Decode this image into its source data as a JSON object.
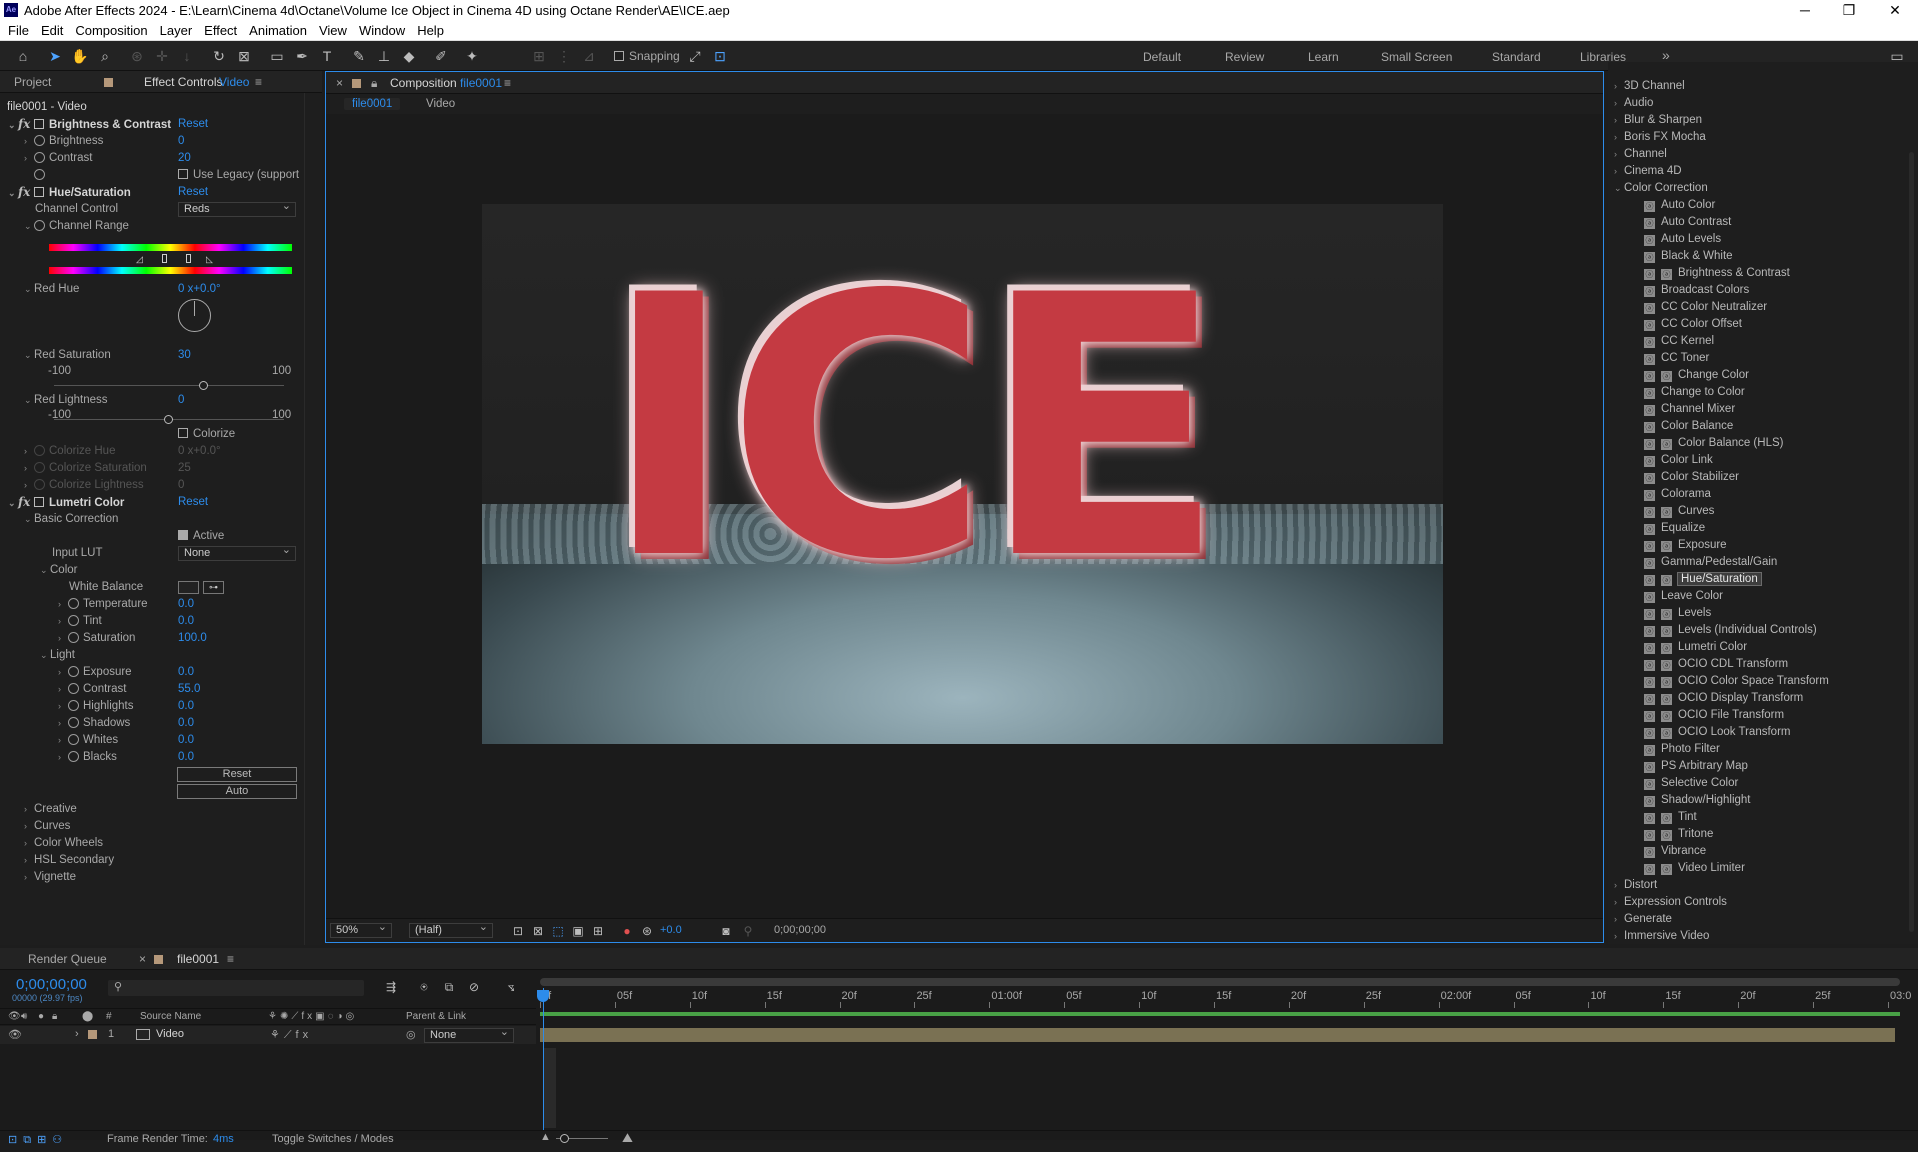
{
  "title_bar": {
    "app_icon": "Ae",
    "title": "Adobe After Effects 2024 - E:\\Learn\\Cinema 4d\\Octane\\Volume Ice Object in Cinema 4D using Octane Render\\AE\\ICE.aep",
    "minimize": "─",
    "maximize": "❐",
    "close": "✕"
  },
  "menu": [
    "File",
    "Edit",
    "Composition",
    "Layer",
    "Effect",
    "Animation",
    "View",
    "Window",
    "Help"
  ],
  "toolbar": {
    "snapping_label": "Snapping",
    "workspaces": [
      "Default",
      "Review",
      "Learn",
      "Small Screen",
      "Standard",
      "Libraries"
    ],
    "more": "»"
  },
  "effect_controls": {
    "tab_project": "Project",
    "tab_effect_controls": "Effect Controls",
    "tab_layer": "Video",
    "layer_path": "file0001 - Video",
    "brightness_contrast": {
      "name": "Brightness & Contrast",
      "reset": "Reset",
      "brightness_label": "Brightness",
      "brightness_value": "0",
      "contrast_label": "Contrast",
      "contrast_value": "20",
      "legacy_label": "Use Legacy (support"
    },
    "hue_saturation": {
      "name": "Hue/Saturation",
      "reset": "Reset",
      "channel_control_label": "Channel Control",
      "channel_control_value": "Reds",
      "channel_range_label": "Channel Range",
      "red_hue_label": "Red Hue",
      "red_hue_value": "0 x+0.0°",
      "red_sat_label": "Red Saturation",
      "red_sat_value": "30",
      "red_sat_min": "-100",
      "red_sat_max": "100",
      "red_sat_level": 0.65,
      "red_light_label": "Red Lightness",
      "red_light_value": "0",
      "red_light_min": "-100",
      "red_light_max": "100",
      "red_light_level": 0.5,
      "colorize_label": "Colorize",
      "colorize_hue_label": "Colorize Hue",
      "colorize_hue_value": "0 x+0.0°",
      "colorize_sat_label": "Colorize Saturation",
      "colorize_sat_value": "25",
      "colorize_light_label": "Colorize Lightness",
      "colorize_light_value": "0"
    },
    "lumetri": {
      "name": "Lumetri Color",
      "reset": "Reset",
      "basic_correction": "Basic Correction",
      "active_label": "Active",
      "input_lut_label": "Input LUT",
      "input_lut_value": "None",
      "color_group": "Color",
      "white_balance_label": "White Balance",
      "temperature_label": "Temperature",
      "temperature_value": "0.0",
      "tint_label": "Tint",
      "tint_value": "0.0",
      "saturation_label": "Saturation",
      "saturation_value": "100.0",
      "light_group": "Light",
      "exposure_label": "Exposure",
      "exposure_value": "0.0",
      "contrast_label": "Contrast",
      "contrast_value": "55.0",
      "highlights_label": "Highlights",
      "highlights_value": "0.0",
      "shadows_label": "Shadows",
      "shadows_value": "0.0",
      "whites_label": "Whites",
      "whites_value": "0.0",
      "blacks_label": "Blacks",
      "blacks_value": "0.0",
      "reset_button": "Reset",
      "auto_button": "Auto",
      "sections": [
        "Creative",
        "Curves",
        "Color Wheels",
        "HSL Secondary",
        "Vignette"
      ]
    }
  },
  "composition": {
    "tab_prefix": "Composition",
    "tab_name": "file0001",
    "breadcrumb_comp": "file0001",
    "breadcrumb_layer": "Video",
    "viewer_text": "ICE",
    "footer": {
      "zoom": "50%",
      "resolution": "(Half)",
      "exposure": "+0.0",
      "timecode": "0;00;00;00"
    }
  },
  "effects_panel": {
    "top_categories": [
      "3D Channel",
      "Audio",
      "Blur & Sharpen",
      "Boris FX Mocha",
      "Channel",
      "Cinema 4D"
    ],
    "open_category": "Color Correction",
    "items": [
      {
        "label": "Auto Color",
        "badge": false
      },
      {
        "label": "Auto Contrast",
        "badge": false
      },
      {
        "label": "Auto Levels",
        "badge": false
      },
      {
        "label": "Black & White",
        "badge": false
      },
      {
        "label": "Brightness & Contrast",
        "badge": true
      },
      {
        "label": "Broadcast Colors",
        "badge": false
      },
      {
        "label": "CC Color Neutralizer",
        "badge": false
      },
      {
        "label": "CC Color Offset",
        "badge": false
      },
      {
        "label": "CC Kernel",
        "badge": false
      },
      {
        "label": "CC Toner",
        "badge": false
      },
      {
        "label": "Change Color",
        "badge": true
      },
      {
        "label": "Change to Color",
        "badge": false
      },
      {
        "label": "Channel Mixer",
        "badge": false
      },
      {
        "label": "Color Balance",
        "badge": false
      },
      {
        "label": "Color Balance (HLS)",
        "badge": true
      },
      {
        "label": "Color Link",
        "badge": false
      },
      {
        "label": "Color Stabilizer",
        "badge": false
      },
      {
        "label": "Colorama",
        "badge": false
      },
      {
        "label": "Curves",
        "badge": true
      },
      {
        "label": "Equalize",
        "badge": false
      },
      {
        "label": "Exposure",
        "badge": true
      },
      {
        "label": "Gamma/Pedestal/Gain",
        "badge": false
      },
      {
        "label": "Hue/Saturation",
        "badge": true
      },
      {
        "label": "Leave Color",
        "badge": false
      },
      {
        "label": "Levels",
        "badge": true
      },
      {
        "label": "Levels (Individual Controls)",
        "badge": true
      },
      {
        "label": "Lumetri Color",
        "badge": true
      },
      {
        "label": "OCIO CDL Transform",
        "badge": true
      },
      {
        "label": "OCIO Color Space Transform",
        "badge": true
      },
      {
        "label": "OCIO Display Transform",
        "badge": true
      },
      {
        "label": "OCIO File Transform",
        "badge": true
      },
      {
        "label": "OCIO Look Transform",
        "badge": true
      },
      {
        "label": "Photo Filter",
        "badge": false
      },
      {
        "label": "PS Arbitrary Map",
        "badge": false
      },
      {
        "label": "Selective Color",
        "badge": false
      },
      {
        "label": "Shadow/Highlight",
        "badge": false
      },
      {
        "label": "Tint",
        "badge": true
      },
      {
        "label": "Tritone",
        "badge": true
      },
      {
        "label": "Vibrance",
        "badge": false
      },
      {
        "label": "Video Limiter",
        "badge": true
      }
    ],
    "selected_item": "Hue/Saturation",
    "bottom_categories": [
      "Distort",
      "Expression Controls",
      "Generate",
      "Immersive Video"
    ]
  },
  "timeline": {
    "tab_render_queue": "Render Queue",
    "tab_comp": "file0001",
    "timecode": "0;00;00;00",
    "frame_info": "00000 (29.97 fps)",
    "search_placeholder": "",
    "col_hash": "#",
    "col_source": "Source Name",
    "col_parent": "Parent & Link",
    "layer_index": "1",
    "layer_name": "Video",
    "layer_parent": "None",
    "ruler": [
      "0f",
      "05f",
      "10f",
      "15f",
      "20f",
      "25f",
      "01:00f",
      "05f",
      "10f",
      "15f",
      "20f",
      "25f",
      "02:00f",
      "05f",
      "10f",
      "15f",
      "20f",
      "25f",
      "03:0"
    ],
    "status_label": "Frame Render Time:",
    "status_value": "4ms",
    "toggle_label": "Toggle Switches / Modes"
  }
}
